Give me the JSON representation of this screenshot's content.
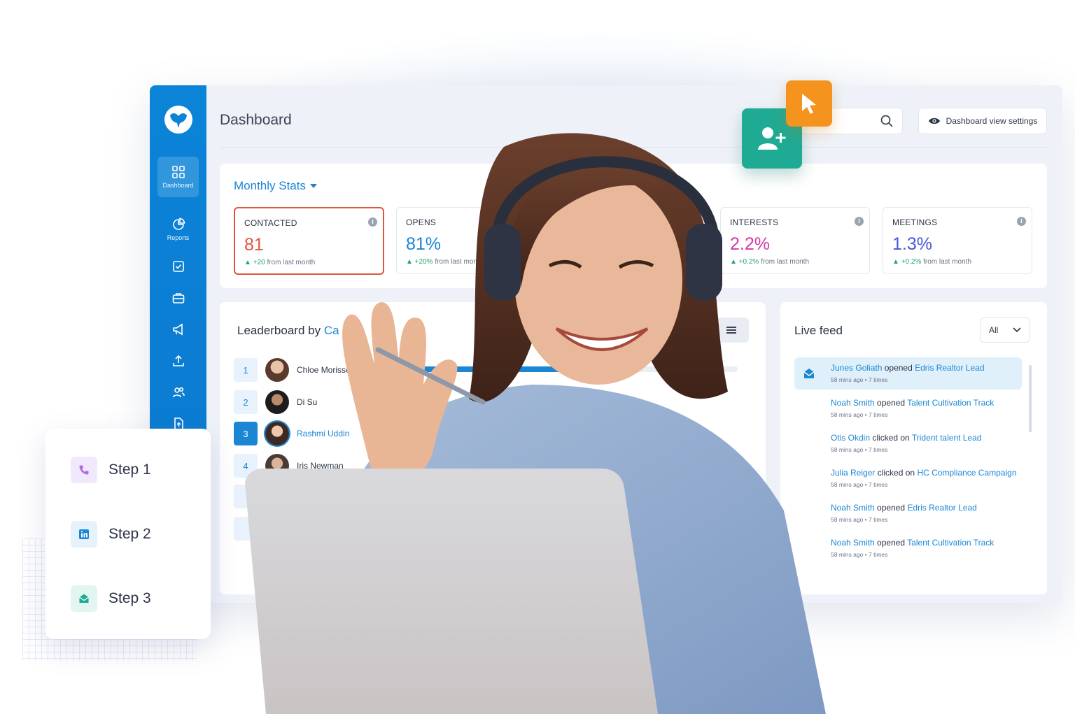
{
  "topbar": {
    "title": "Dashboard",
    "search_placeholder": "",
    "view_settings_label": "Dashboard view settings"
  },
  "sidebar": {
    "items": [
      {
        "label": "Dashboard",
        "icon": "grid-icon",
        "active": true
      },
      {
        "label": "Reports",
        "icon": "pie-chart-icon"
      },
      {
        "label": "",
        "icon": "checkbox-icon"
      },
      {
        "label": "",
        "icon": "briefcase-icon"
      },
      {
        "label": "",
        "icon": "megaphone-icon"
      },
      {
        "label": "",
        "icon": "upload-icon"
      },
      {
        "label": "",
        "icon": "users-icon"
      },
      {
        "label": "",
        "icon": "file-upload-icon"
      }
    ]
  },
  "stats": {
    "title": "Monthly Stats",
    "cards": [
      {
        "name": "CONTACTED",
        "value": "81",
        "delta": "+20",
        "delta_suffix": "from last month",
        "color": "#e0563d"
      },
      {
        "name": "OPENS",
        "value": "81%",
        "delta": "+20%",
        "delta_suffix": "from last month",
        "color": "#1a86d4"
      },
      {
        "name": "INTERESTS",
        "value": "2.2%",
        "delta": "+0.2%",
        "delta_suffix": "from last month",
        "color": "#d23aa6"
      },
      {
        "name": "MEETINGS",
        "value": "1.3%",
        "delta": "+0.2%",
        "delta_suffix": "from last month",
        "color": "#4a56d8"
      }
    ]
  },
  "leaderboard": {
    "title_prefix": "Leaderboard by ",
    "title_accent": "Ca",
    "rows": [
      {
        "rank": "1",
        "name": "Chloe Morisse",
        "progress": 0.55
      },
      {
        "rank": "2",
        "name": "Di Su"
      },
      {
        "rank": "3",
        "name": "Rashmi Uddin",
        "active": true
      },
      {
        "rank": "4",
        "name": "Iris Newman"
      }
    ]
  },
  "feed": {
    "title": "Live feed",
    "filter": "All",
    "items": [
      {
        "actor": "Junes Goliath",
        "verb": "opened",
        "target": "Edris Realtor Lead",
        "time": "58 mins ago",
        "count": "7 times",
        "highlight": true
      },
      {
        "actor": "Noah Smith",
        "verb": "opened",
        "target": "Talent Cultivation Track",
        "time": "58 mins ago",
        "count": "7 times"
      },
      {
        "actor": "Otis Okdin",
        "verb": "clicked on",
        "target": "Trident talent Lead",
        "time": "58 mins ago",
        "count": "7 times"
      },
      {
        "actor": "Julia Reiger",
        "verb": "clicked on",
        "target": "HC Compliance Campaign",
        "time": "58 mins ago",
        "count": "7 times"
      },
      {
        "actor": "Noah Smith",
        "verb": "opened",
        "target": "Edris Realtor Lead",
        "time": "58 mins ago",
        "count": "7 times"
      },
      {
        "actor": "Noah Smith",
        "verb": "opened",
        "target": "Talent Cultivation Track",
        "time": "58 mins ago",
        "count": "7 times"
      }
    ]
  },
  "steps": [
    {
      "label": "Step 1",
      "icon": "phone-icon",
      "color": "#b06be6",
      "bg": "#f1e9fb"
    },
    {
      "label": "Step 2",
      "icon": "linkedin-icon",
      "color": "#1a86d4",
      "bg": "#e5f1fb"
    },
    {
      "label": "Step 3",
      "icon": "mail-open-icon",
      "color": "#1faa94",
      "bg": "#e3f5f1"
    }
  ],
  "floating": {
    "add_user_icon": "add-user-icon",
    "cursor_icon": "cursor-icon"
  }
}
